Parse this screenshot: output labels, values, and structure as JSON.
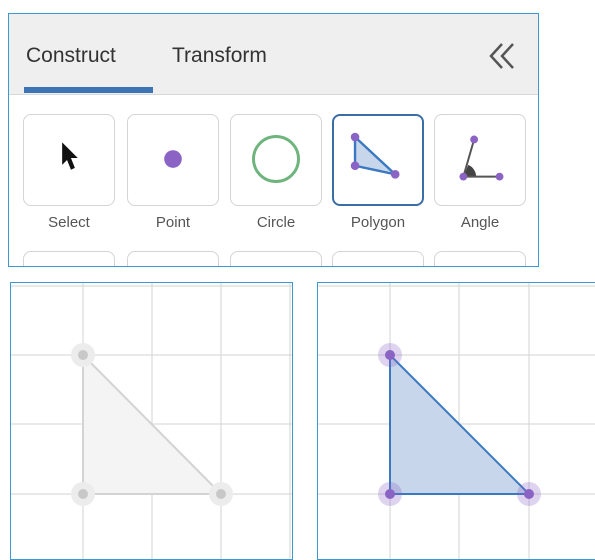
{
  "tabs": [
    {
      "label": "Construct",
      "active": true
    },
    {
      "label": "Transform",
      "active": false
    }
  ],
  "collapse_icon": "double-chevron-left-icon",
  "tools": [
    {
      "label": "Select",
      "icon": "arrow-cursor-icon",
      "active": false
    },
    {
      "label": "Point",
      "icon": "point-icon",
      "active": false
    },
    {
      "label": "Circle",
      "icon": "circle-icon",
      "active": false
    },
    {
      "label": "Polygon",
      "icon": "polygon-icon",
      "active": true
    },
    {
      "label": "Angle",
      "icon": "angle-icon",
      "active": false
    }
  ],
  "colors": {
    "accent": "#3c74b5",
    "border": "#3d9ad1",
    "point": "#8a63c4",
    "circle": "#6fb37d",
    "polygon_fill": "#c7d6ea",
    "polygon_stroke": "#3a78c1",
    "inactive_shape": "#cfcfcf"
  },
  "canvases": [
    {
      "name": "inactive-canvas",
      "state": "preview"
    },
    {
      "name": "active-canvas",
      "state": "drawn"
    }
  ]
}
